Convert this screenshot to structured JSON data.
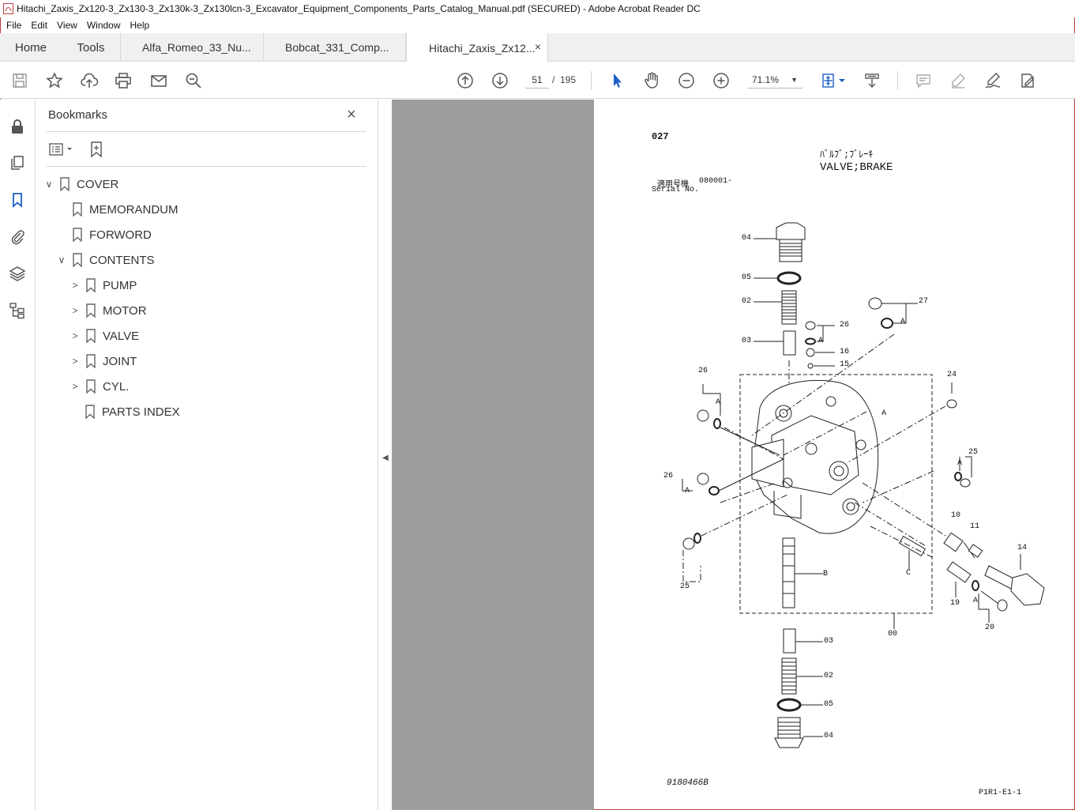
{
  "window": {
    "title": "Hitachi_Zaxis_Zx120-3_Zx130-3_Zx130k-3_Zx130lcn-3_Excavator_Equipment_Components_Parts_Catalog_Manual.pdf (SECURED) - Adobe Acrobat Reader DC",
    "accent_color": "#c43b3b"
  },
  "menu": [
    "File",
    "Edit",
    "View",
    "Window",
    "Help"
  ],
  "tabs": {
    "home": "Home",
    "tools": "Tools",
    "docs": [
      "Alfa_Romeo_33_Nu...",
      "Bobcat_331_Comp...",
      "Hitachi_Zaxis_Zx12..."
    ],
    "close": "×"
  },
  "toolbar": {
    "page_current": "51",
    "page_sep": "/",
    "page_total": "195",
    "zoom": "71.1%"
  },
  "rail_icons": [
    "lock-icon",
    "copy-pages-icon",
    "bookmark-icon",
    "attachment-icon",
    "layers-icon",
    "structure-icon"
  ],
  "bookmarks": {
    "title": "Bookmarks",
    "close": "×",
    "items": [
      {
        "label": "COVER",
        "expanded": true
      },
      {
        "label": "MEMORANDUM"
      },
      {
        "label": "FORWORD"
      },
      {
        "label": "CONTENTS",
        "expanded": true
      },
      {
        "label": "PUMP"
      },
      {
        "label": "MOTOR"
      },
      {
        "label": "VALVE"
      },
      {
        "label": "JOINT"
      },
      {
        "label": "CYL."
      },
      {
        "label": "PARTS INDEX"
      }
    ]
  },
  "page": {
    "number": "027",
    "title_jp": "ﾊﾞﾙﾌﾞ;ﾌﾞﾚｰｷ",
    "title_en": "VALVE;BRAKE",
    "serial_jp": "適用号機",
    "serial_label": "Serial No.",
    "serial_value": "080001-",
    "drawing_no": "9180466B",
    "ref": "P1R1-E1-1",
    "callouts": [
      "04",
      "05",
      "02",
      "03",
      "27",
      "26",
      "16",
      "15",
      "26",
      "24",
      "A",
      "A",
      "A",
      "A",
      "A",
      "25",
      "26",
      "A",
      "10",
      "11",
      "14",
      "25",
      "B",
      "C",
      "19",
      "20",
      "00",
      "03",
      "02",
      "05",
      "04",
      "A"
    ]
  }
}
